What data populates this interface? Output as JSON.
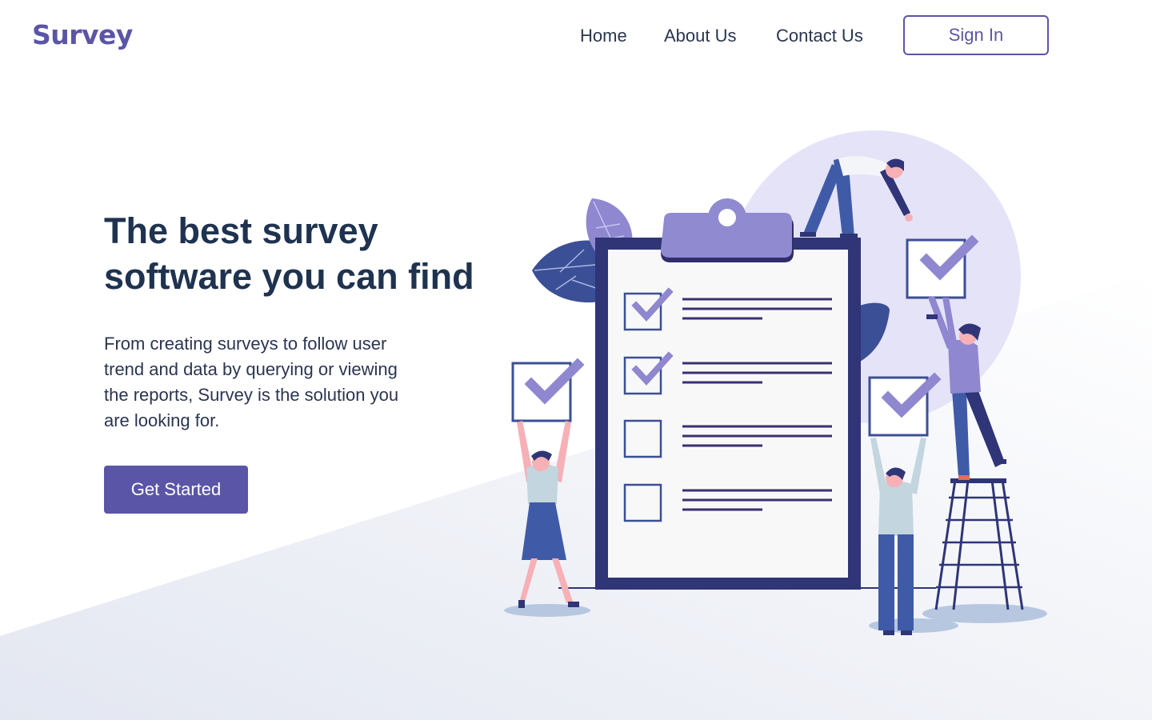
{
  "header": {
    "logo": "Survey",
    "nav": [
      {
        "label": "Home"
      },
      {
        "label": "About Us"
      },
      {
        "label": "Contact Us"
      }
    ],
    "sign_in_label": "Sign In"
  },
  "hero": {
    "title": "The best survey software you can find",
    "description": "From creating surveys to follow user trend and data by querying or viewing the reports, Survey is the solution you are looking for.",
    "cta_label": "Get Started"
  },
  "illustration": {
    "icon": "clipboard-checklist-illustration",
    "checklist_items": [
      {
        "checked": true
      },
      {
        "checked": true
      },
      {
        "checked": false
      },
      {
        "checked": false
      }
    ]
  },
  "colors": {
    "brand": "#5b55a8",
    "heading": "#1f3350",
    "text": "#2a3550",
    "clipboard_frame": "#2f3576",
    "check": "#8f87cf"
  }
}
